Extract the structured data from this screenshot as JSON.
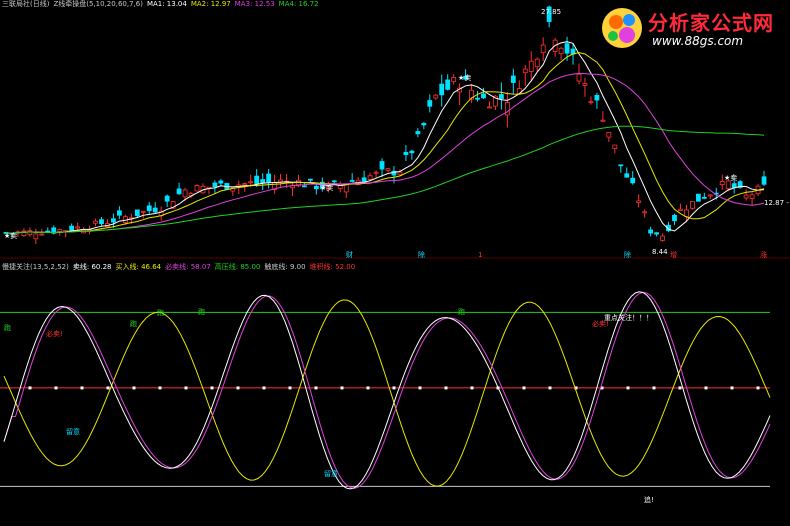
{
  "top_legend": [
    {
      "text": "三联局社(日线)",
      "color": "#c8c8c8"
    },
    {
      "text": "Z线牵操盘(5,10,20,60,7,6)",
      "color": "#c8c8c8"
    },
    {
      "text": "MA1: 13.04",
      "color": "#ffffff"
    },
    {
      "text": "MA2: 12.97",
      "color": "#e8e800"
    },
    {
      "text": "MA3: 12.53",
      "color": "#e040e0"
    },
    {
      "text": "MA4: 16.72",
      "color": "#20d020"
    }
  ],
  "bottom_legend": [
    {
      "text": "慢捷关注(13,5,2,52)",
      "color": "#c8c8c8"
    },
    {
      "text": "卖线: 60.28",
      "color": "#ffffff"
    },
    {
      "text": "买入线: 46.64",
      "color": "#e8e800"
    },
    {
      "text": "必卖线: 58.07",
      "color": "#e040e0"
    },
    {
      "text": "高压线: 85.00",
      "color": "#20d020"
    },
    {
      "text": "触底线: 9.00",
      "color": "#c8c8c8"
    },
    {
      "text": "堆积线: 52.00",
      "color": "#ff3030"
    }
  ],
  "watermark": {
    "title": "分析家公式网",
    "url": "www.88gs.com"
  },
  "colors": {
    "up": "#ff3030",
    "down": "#00e0ff",
    "ma1": "#ffffff",
    "ma2": "#e8e800",
    "ma3": "#e040e0",
    "ma4": "#20d020",
    "osc_white": "#ffffff",
    "osc_yellow": "#e8e800",
    "osc_magenta": "#e040e0",
    "osc_green": "#20d020",
    "osc_gray": "#c8c8c8",
    "osc_red": "#ff3030"
  },
  "chart_data": [
    {
      "type": "candlestick",
      "annotations": [
        {
          "text": "27.85",
          "kind": "high"
        },
        {
          "text": "8.44",
          "kind": "low"
        },
        {
          "text": "12.87 - 1",
          "kind": "last"
        },
        {
          "text": "★卖",
          "kind": "signal"
        },
        {
          "text": "★卖",
          "kind": "signal"
        },
        {
          "text": "★卖",
          "kind": "signal"
        },
        {
          "text": "★卖",
          "kind": "signal"
        },
        {
          "text": "财",
          "kind": "event"
        },
        {
          "text": "除",
          "kind": "event"
        },
        {
          "text": "1",
          "kind": "event"
        },
        {
          "text": "除",
          "kind": "event"
        },
        {
          "text": "增",
          "kind": "event"
        },
        {
          "text": "涨",
          "kind": "event"
        }
      ],
      "price_range": [
        8.44,
        27.85
      ]
    },
    {
      "type": "line",
      "levels": [
        {
          "name": "高压线",
          "value": 85,
          "color": "#20d020"
        },
        {
          "name": "堆积线",
          "value": 52,
          "color": "#ff3030"
        },
        {
          "name": "触底线",
          "value": 9,
          "color": "#c8c8c8"
        }
      ],
      "labels": [
        {
          "text": "跑",
          "color": "#20d020"
        },
        {
          "text": "跑",
          "color": "#20d020"
        },
        {
          "text": "跑",
          "color": "#20d020"
        },
        {
          "text": "跑",
          "color": "#20d020"
        },
        {
          "text": "跑",
          "color": "#20d020"
        },
        {
          "text": "必卖!",
          "color": "#ff3030"
        },
        {
          "text": "必卖!",
          "color": "#ff3030"
        },
        {
          "text": "重点关注！！！",
          "color": "#ffffff"
        },
        {
          "text": "留意",
          "color": "#00e0ff"
        },
        {
          "text": "留意",
          "color": "#00e0ff"
        },
        {
          "text": "追!",
          "color": "#ffffff"
        }
      ],
      "ylim": [
        0,
        100
      ]
    }
  ]
}
